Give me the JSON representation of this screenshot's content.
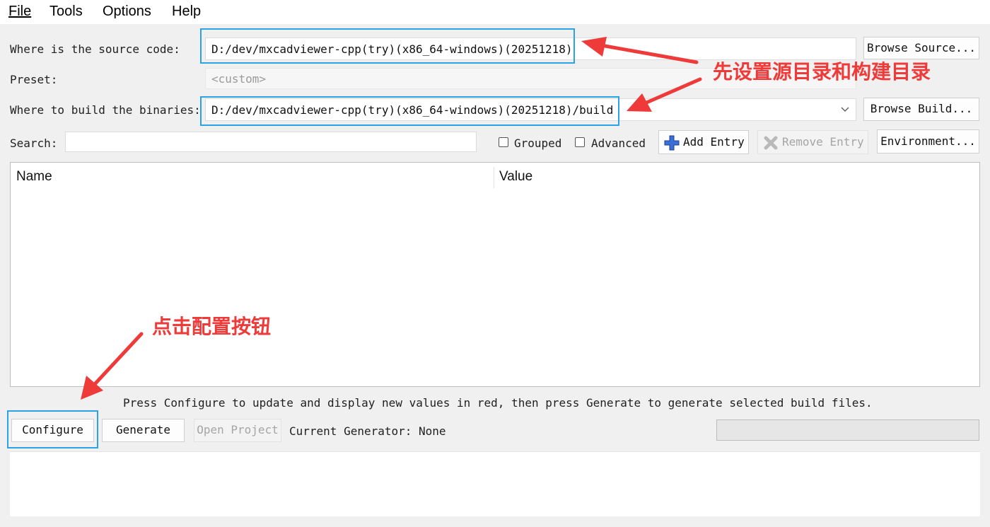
{
  "menu": {
    "file": "File",
    "tools": "Tools",
    "options": "Options",
    "help": "Help"
  },
  "source": {
    "label": "Where is the source code:",
    "value": "D:/dev/mxcadviewer-cpp(try)(x86_64-windows)(20251218)",
    "browse_label": "Browse Source..."
  },
  "preset": {
    "label": "Preset:",
    "value": "<custom>"
  },
  "build": {
    "label": "Where to build the binaries:",
    "value": "D:/dev/mxcadviewer-cpp(try)(x86_64-windows)(20251218)/build",
    "browse_label": "Browse Build..."
  },
  "search": {
    "label": "Search:",
    "value": ""
  },
  "options": {
    "grouped_label": "Grouped",
    "advanced_label": "Advanced",
    "add_entry_label": "Add Entry",
    "remove_entry_label": "Remove Entry",
    "environment_label": "Environment..."
  },
  "table": {
    "columns": [
      "Name",
      "Value"
    ],
    "rows": []
  },
  "hint": "Press Configure to update and display new values in red, then press Generate to generate selected build files.",
  "actions": {
    "configure_label": "Configure",
    "generate_label": "Generate",
    "open_project_label": "Open Project",
    "current_generator": "Current Generator: None",
    "progress": 0
  },
  "annotations": {
    "set_dirs": "先设置源目录和构建目录",
    "click_configure": "点击配置按钮"
  },
  "colors": {
    "highlight_box": "#29a3e5",
    "annotation_red": "#ef3a3a",
    "window_bg": "#f0f0f0"
  },
  "icons": {
    "add": "plus-cross-icon",
    "remove": "x-icon",
    "dropdown": "chevron-down-icon"
  }
}
